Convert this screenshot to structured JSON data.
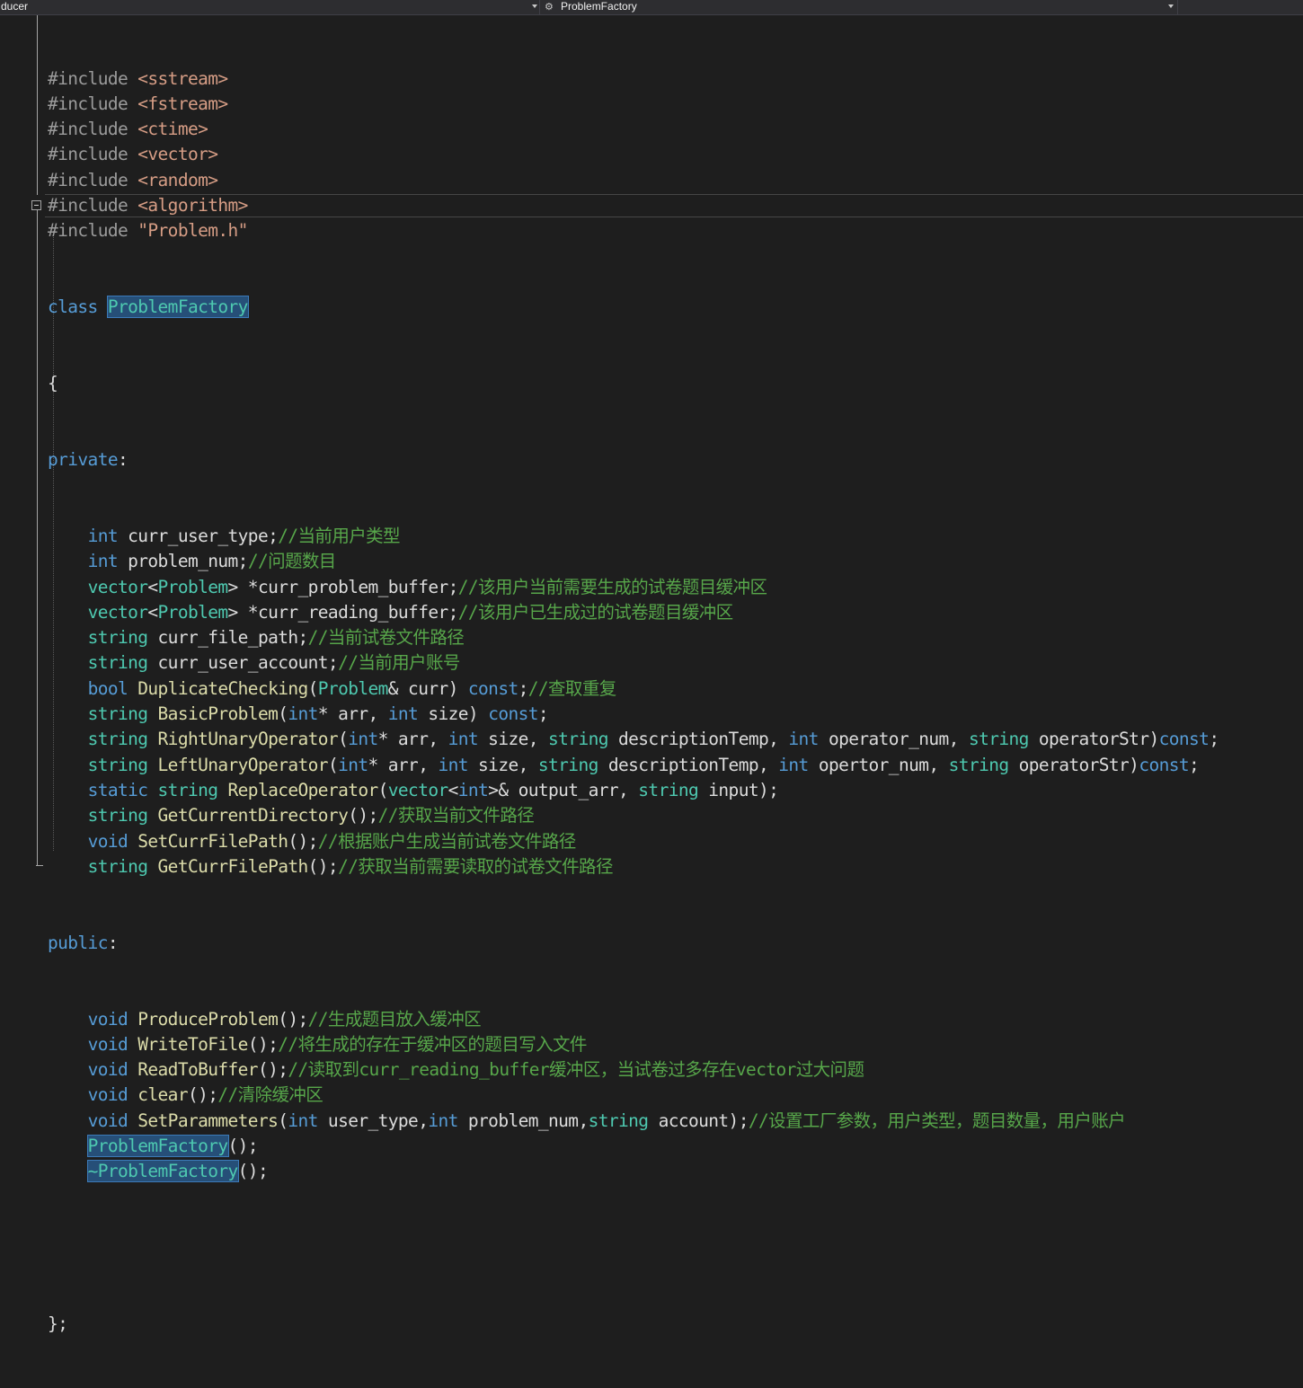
{
  "navbar": {
    "project": "ducer",
    "symbol": "ProblemFactory"
  },
  "code": {
    "includes": [
      {
        "directive": "#include",
        "file": "<sstream>"
      },
      {
        "directive": "#include",
        "file": "<fstream>"
      },
      {
        "directive": "#include",
        "file": "<ctime>"
      },
      {
        "directive": "#include",
        "file": "<vector>"
      },
      {
        "directive": "#include",
        "file": "<random>"
      },
      {
        "directive": "#include",
        "file": "<algorithm>"
      },
      {
        "directive": "#include",
        "file": "\"Problem.h\""
      }
    ],
    "class_kw": "class",
    "class_name": "ProblemFactory",
    "open_brace": "{",
    "private_label": "private",
    "public_label": "public",
    "close": "};",
    "private_members": [
      {
        "tokens": [
          [
            "kw",
            "int"
          ],
          [
            "pl",
            " curr_user_type;"
          ],
          [
            "cm",
            "//当前用户类型"
          ]
        ]
      },
      {
        "tokens": [
          [
            "kw",
            "int"
          ],
          [
            "pl",
            " problem_num;"
          ],
          [
            "cm",
            "//问题数目"
          ]
        ]
      },
      {
        "tokens": [
          [
            "ty",
            "vector"
          ],
          [
            "pl",
            "<"
          ],
          [
            "ty",
            "Problem"
          ],
          [
            "pl",
            "> *curr_problem_buffer;"
          ],
          [
            "cm",
            "//该用户当前需要生成的试卷题目缓冲区"
          ]
        ]
      },
      {
        "tokens": [
          [
            "ty",
            "vector"
          ],
          [
            "pl",
            "<"
          ],
          [
            "ty",
            "Problem"
          ],
          [
            "pl",
            "> *curr_reading_buffer;"
          ],
          [
            "cm",
            "//该用户已生成过的试卷题目缓冲区"
          ]
        ]
      },
      {
        "tokens": [
          [
            "ty",
            "string"
          ],
          [
            "pl",
            " curr_file_path;"
          ],
          [
            "cm",
            "//当前试卷文件路径"
          ]
        ]
      },
      {
        "tokens": [
          [
            "ty",
            "string"
          ],
          [
            "pl",
            " curr_user_account;"
          ],
          [
            "cm",
            "//当前用户账号"
          ]
        ]
      },
      {
        "tokens": [
          [
            "kw",
            "bool"
          ],
          [
            "pl",
            " "
          ],
          [
            "fn",
            "DuplicateChecking"
          ],
          [
            "pl",
            "("
          ],
          [
            "ty",
            "Problem"
          ],
          [
            "pl",
            "& curr) "
          ],
          [
            "kw",
            "const"
          ],
          [
            "pl",
            ";"
          ],
          [
            "cm",
            "//查取重复"
          ]
        ]
      },
      {
        "tokens": [
          [
            "ty",
            "string"
          ],
          [
            "pl",
            " "
          ],
          [
            "fn",
            "BasicProblem"
          ],
          [
            "pl",
            "("
          ],
          [
            "kw",
            "int"
          ],
          [
            "pl",
            "* arr, "
          ],
          [
            "kw",
            "int"
          ],
          [
            "pl",
            " size) "
          ],
          [
            "kw",
            "const"
          ],
          [
            "pl",
            ";"
          ]
        ]
      },
      {
        "tokens": [
          [
            "ty",
            "string"
          ],
          [
            "pl",
            " "
          ],
          [
            "fn",
            "RightUnaryOperator"
          ],
          [
            "pl",
            "("
          ],
          [
            "kw",
            "int"
          ],
          [
            "pl",
            "* arr, "
          ],
          [
            "kw",
            "int"
          ],
          [
            "pl",
            " size, "
          ],
          [
            "ty",
            "string"
          ],
          [
            "pl",
            " descriptionTemp, "
          ],
          [
            "kw",
            "int"
          ],
          [
            "pl",
            " operator_num, "
          ],
          [
            "ty",
            "string"
          ],
          [
            "pl",
            " operatorStr)"
          ],
          [
            "kw",
            "const"
          ],
          [
            "pl",
            ";"
          ]
        ]
      },
      {
        "tokens": [
          [
            "ty",
            "string"
          ],
          [
            "pl",
            " "
          ],
          [
            "fn",
            "LeftUnaryOperator"
          ],
          [
            "pl",
            "("
          ],
          [
            "kw",
            "int"
          ],
          [
            "pl",
            "* arr, "
          ],
          [
            "kw",
            "int"
          ],
          [
            "pl",
            " size, "
          ],
          [
            "ty",
            "string"
          ],
          [
            "pl",
            " descriptionTemp, "
          ],
          [
            "kw",
            "int"
          ],
          [
            "pl",
            " opertor_num, "
          ],
          [
            "ty",
            "string"
          ],
          [
            "pl",
            " operatorStr)"
          ],
          [
            "kw",
            "const"
          ],
          [
            "pl",
            ";"
          ]
        ]
      },
      {
        "tokens": [
          [
            "kw",
            "static"
          ],
          [
            "pl",
            " "
          ],
          [
            "ty",
            "string"
          ],
          [
            "pl",
            " "
          ],
          [
            "fn",
            "ReplaceOperator"
          ],
          [
            "pl",
            "("
          ],
          [
            "ty",
            "vector"
          ],
          [
            "pl",
            "<"
          ],
          [
            "kw",
            "int"
          ],
          [
            "pl",
            ">& output_arr, "
          ],
          [
            "ty",
            "string"
          ],
          [
            "pl",
            " input);"
          ]
        ]
      },
      {
        "tokens": [
          [
            "ty",
            "string"
          ],
          [
            "pl",
            " "
          ],
          [
            "fn",
            "GetCurrentDirectory"
          ],
          [
            "pl",
            "();"
          ],
          [
            "cm",
            "//获取当前文件路径"
          ]
        ]
      },
      {
        "tokens": [
          [
            "kw",
            "void"
          ],
          [
            "pl",
            " "
          ],
          [
            "fn",
            "SetCurrFilePath"
          ],
          [
            "pl",
            "();"
          ],
          [
            "cm",
            "//根据账户生成当前试卷文件路径"
          ]
        ]
      },
      {
        "tokens": [
          [
            "ty",
            "string"
          ],
          [
            "pl",
            " "
          ],
          [
            "fn",
            "GetCurrFilePath"
          ],
          [
            "pl",
            "();"
          ],
          [
            "cm",
            "//获取当前需要读取的试卷文件路径"
          ]
        ]
      }
    ],
    "public_members": [
      {
        "tokens": [
          [
            "kw",
            "void"
          ],
          [
            "pl",
            " "
          ],
          [
            "fn",
            "ProduceProblem"
          ],
          [
            "pl",
            "();"
          ],
          [
            "cm",
            "//生成题目放入缓冲区"
          ]
        ]
      },
      {
        "tokens": [
          [
            "kw",
            "void"
          ],
          [
            "pl",
            " "
          ],
          [
            "fn",
            "WriteToFile"
          ],
          [
            "pl",
            "();"
          ],
          [
            "cm",
            "//将生成的存在于缓冲区的题目写入文件"
          ]
        ]
      },
      {
        "tokens": [
          [
            "kw",
            "void"
          ],
          [
            "pl",
            " "
          ],
          [
            "fn",
            "ReadToBuffer"
          ],
          [
            "pl",
            "();"
          ],
          [
            "cm",
            "//读取到curr_reading_buffer缓冲区，当试卷过多存在vector过大问题"
          ]
        ]
      },
      {
        "tokens": [
          [
            "kw",
            "void"
          ],
          [
            "pl",
            " "
          ],
          [
            "fn",
            "clear"
          ],
          [
            "pl",
            "();"
          ],
          [
            "cm",
            "//清除缓冲区"
          ]
        ]
      },
      {
        "tokens": [
          [
            "kw",
            "void"
          ],
          [
            "pl",
            " "
          ],
          [
            "fn",
            "SetParammeters"
          ],
          [
            "pl",
            "("
          ],
          [
            "kw",
            "int"
          ],
          [
            "pl",
            " user_type,"
          ],
          [
            "kw",
            "int"
          ],
          [
            "pl",
            " problem_num,"
          ],
          [
            "ty",
            "string"
          ],
          [
            "pl",
            " account);"
          ],
          [
            "cm",
            "//设置工厂参数，用户类型，题目数量，用户账户"
          ]
        ]
      },
      {
        "tokens": [
          [
            "hl",
            "ProblemFactory"
          ],
          [
            "pl",
            "();"
          ]
        ]
      },
      {
        "tokens": [
          [
            "hl",
            "~ProblemFactory"
          ],
          [
            "pl",
            "();"
          ]
        ]
      }
    ]
  },
  "colors": {
    "background": "#1e1e1e",
    "keyword": "#569cd6",
    "type": "#4ec9b0",
    "function": "#dcdcaa",
    "string": "#d69d85",
    "preprocessor": "#9b9b9b",
    "comment": "#57a64a",
    "plain": "#dcdcdc",
    "highlight": "#264f78"
  }
}
